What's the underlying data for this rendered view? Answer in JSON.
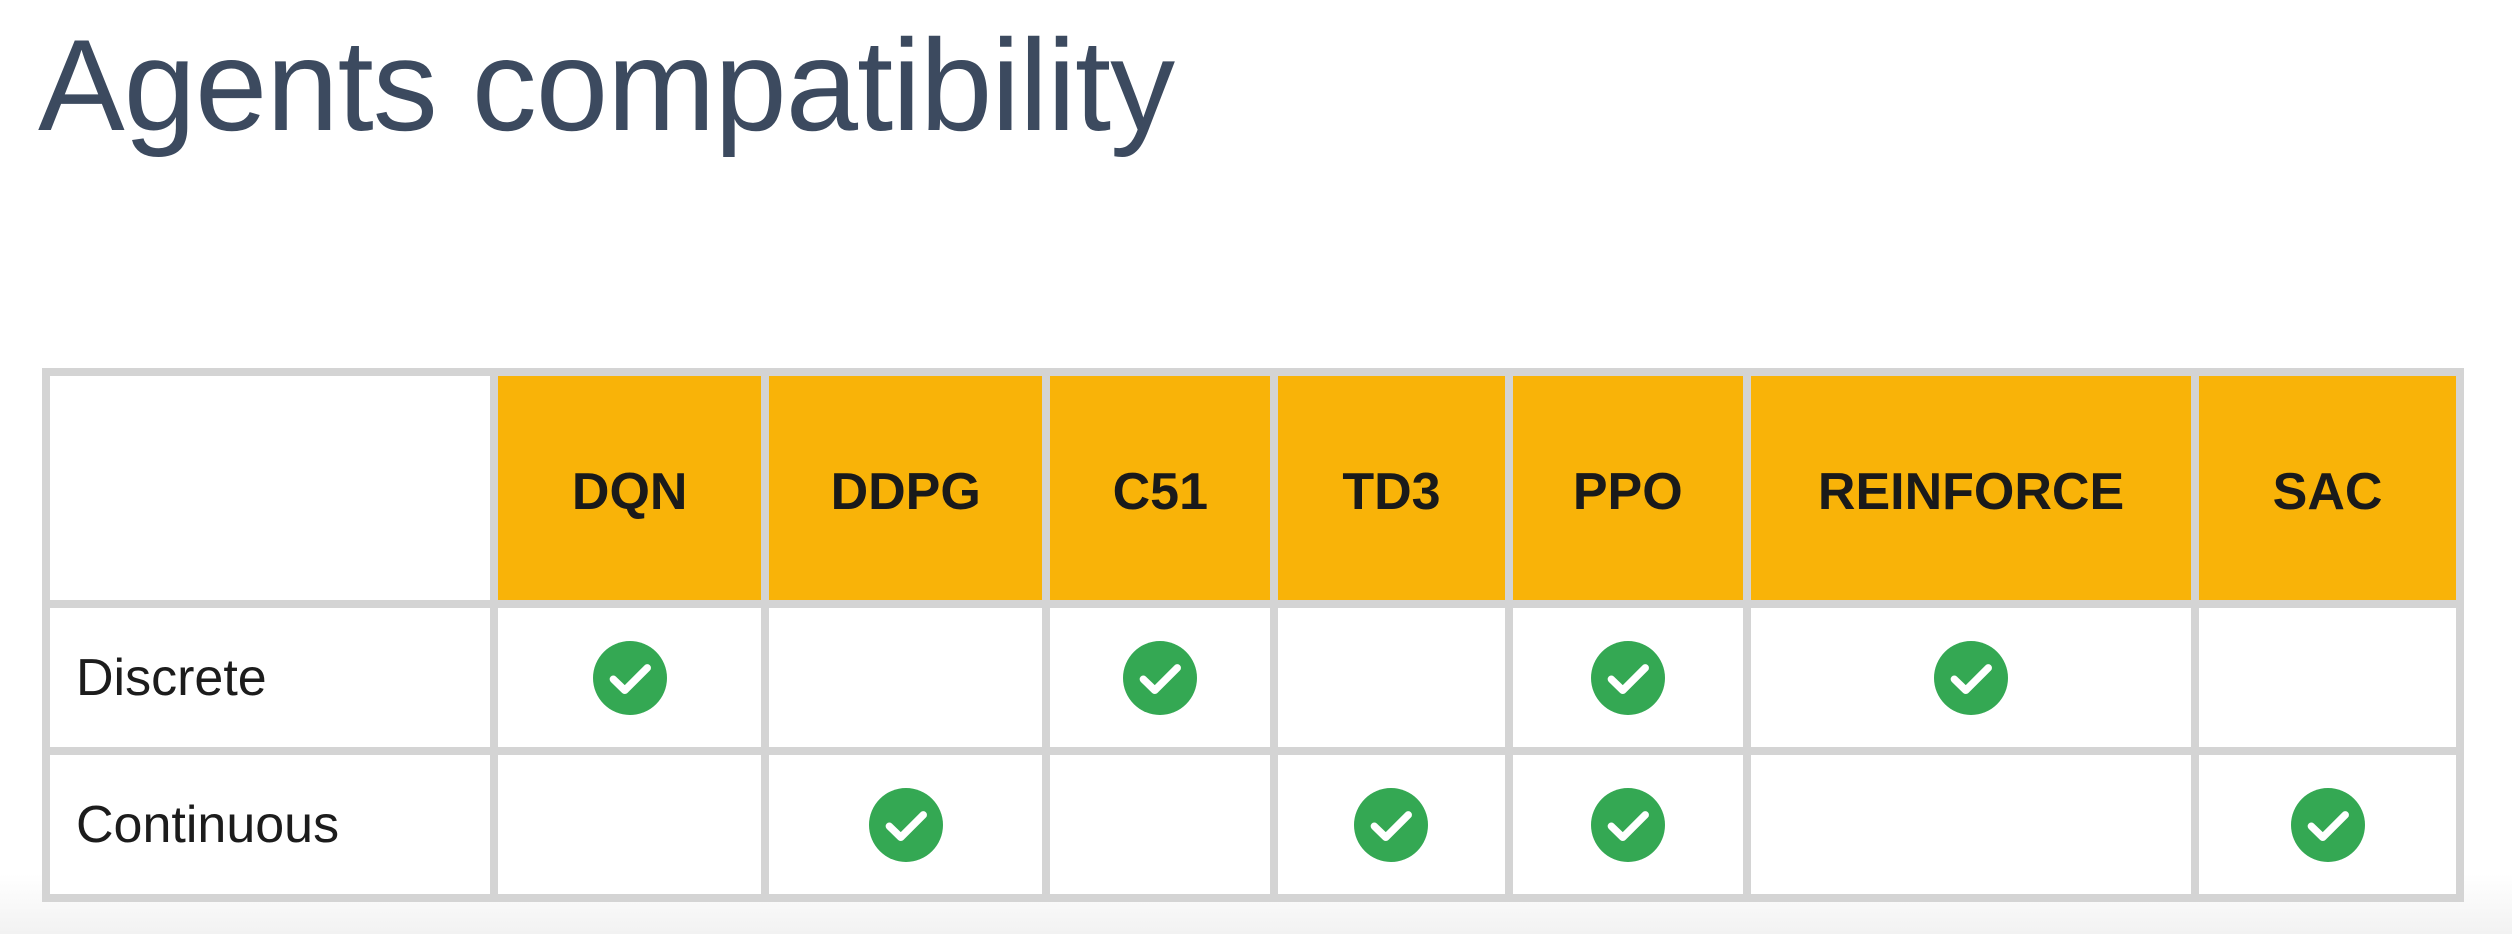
{
  "slide": {
    "title": "Agents compatibility"
  },
  "table": {
    "columns": [
      "DQN",
      "DDPG",
      "C51",
      "TD3",
      "PPO",
      "REINFORCE",
      "SAC"
    ],
    "rows": [
      {
        "label": "Discrete",
        "checks": [
          true,
          false,
          true,
          false,
          true,
          true,
          false
        ]
      },
      {
        "label": "Continuous",
        "checks": [
          false,
          true,
          false,
          true,
          true,
          false,
          true
        ]
      }
    ]
  },
  "colors": {
    "header_fill": "#f9b308",
    "check_fill": "#34a853",
    "grid": "#d4d4d4",
    "title_text": "#3c4a5f"
  },
  "icons": {
    "check": "check-circle-icon"
  }
}
